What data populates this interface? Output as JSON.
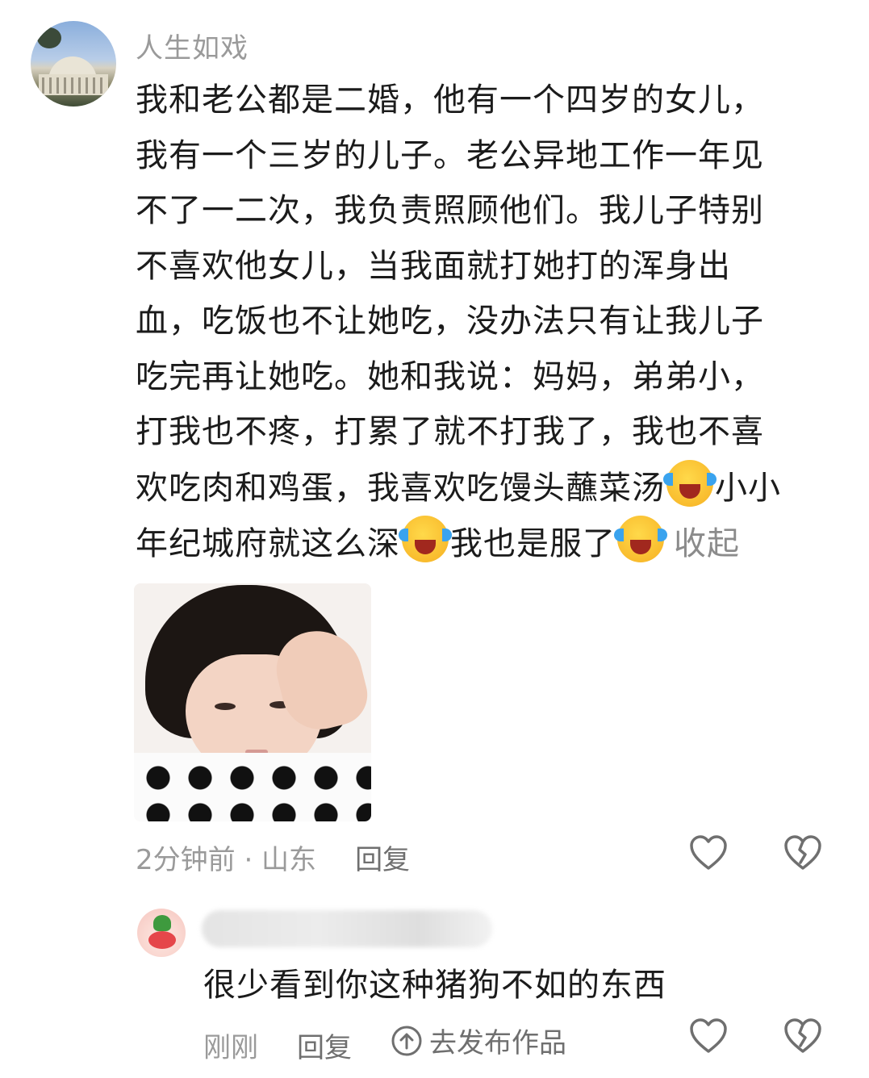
{
  "comment": {
    "username": "人生如戏",
    "lines": [
      "我和老公都是二婚，他有一个四岁的女儿，",
      "我有一个三岁的儿子。老公异地工作一年见",
      "不了一二次，我负责照顾他们。我儿子特别",
      "不喜欢他女儿，当我面就打她打的浑身出",
      "血，吃饭也不让她吃，没办法只有让我儿子",
      "吃完再让她吃。她和我说：妈妈，弟弟小，",
      "打我也不疼，打累了就不打我了，我也不喜"
    ],
    "line8a": "欢吃肉和鸡蛋，我喜欢吃馒头蘸菜汤",
    "line8b": "小小",
    "line9a": "年纪城府就这么深",
    "line9b": "我也是服了",
    "collapse_label": "收起",
    "time": "2分钟前 · 山东",
    "reply_label": "回复",
    "icons": [
      "laugh-cry-emoji",
      "heart-icon",
      "broken-heart-icon"
    ]
  },
  "reply": {
    "text": "很少看到你这种猪狗不如的东西",
    "time": "刚刚",
    "reply_label": "回复",
    "publish_label": "去发布作品",
    "icons": [
      "upload-icon",
      "heart-icon",
      "broken-heart-icon"
    ]
  },
  "colors": {
    "meta": "#9a9a9a",
    "body": "#1b1b1b",
    "icon": "#6f6f6f"
  }
}
